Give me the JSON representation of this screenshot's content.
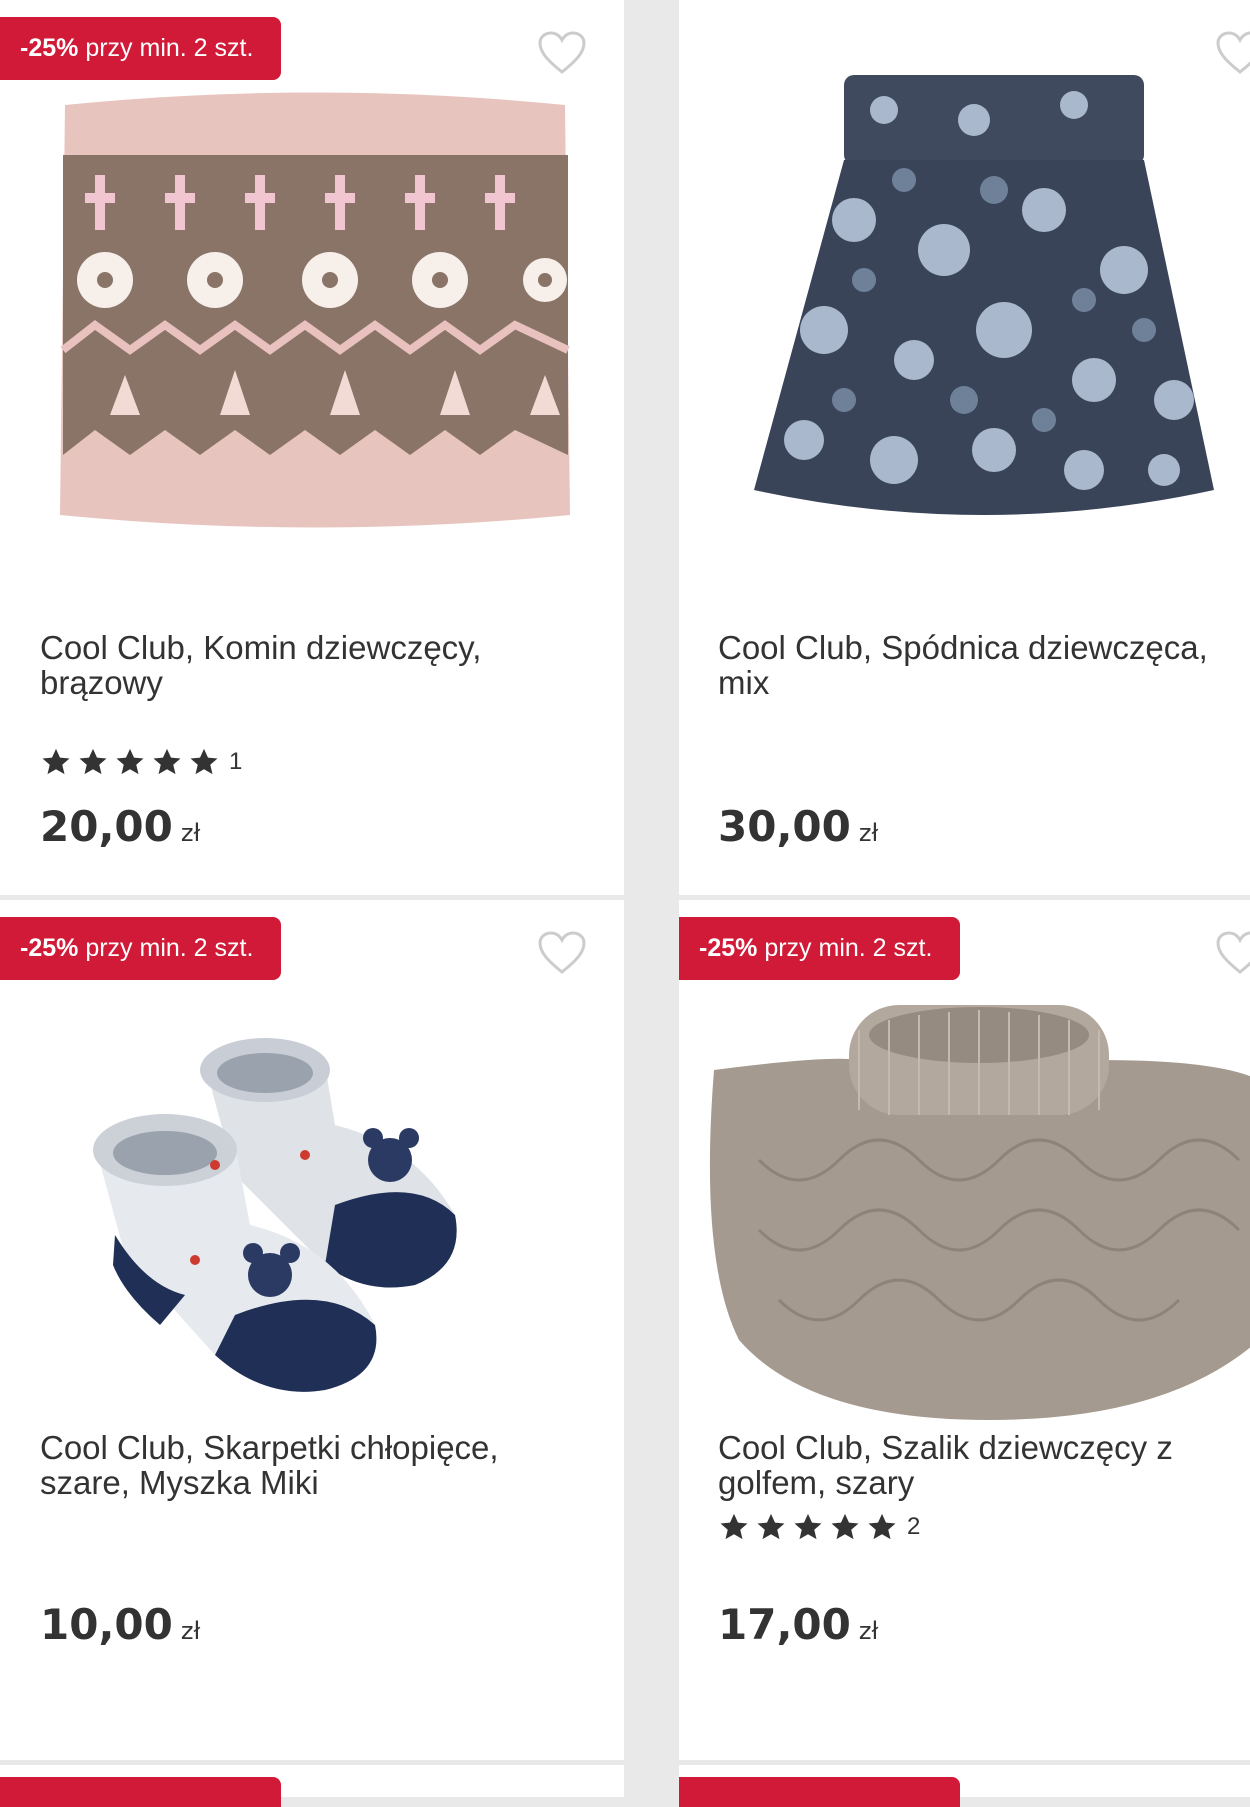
{
  "colors": {
    "badge": "#d11a38",
    "text": "#333333",
    "star": "#333333",
    "heart": "#cccccc"
  },
  "products": [
    {
      "badge": {
        "discount": "-25%",
        "text": " przy min. 2 szt."
      },
      "title": "Cool Club, Komin dziewczęcy, brązowy",
      "rating": {
        "stars": 5,
        "count": "1"
      },
      "price": {
        "amount": "20,00",
        "currency": "zł"
      },
      "image_icon": "knit-neck-warmer-image"
    },
    {
      "badge": null,
      "title": "Cool Club, Spódnica dziewczęca, mix",
      "rating": null,
      "price": {
        "amount": "30,00",
        "currency": "zł"
      },
      "image_icon": "floral-skirt-image"
    },
    {
      "badge": {
        "discount": "-25%",
        "text": " przy min. 2 szt."
      },
      "title": "Cool Club, Skarpetki chłopięce, szare, Myszka Miki",
      "rating": null,
      "price": {
        "amount": "10,00",
        "currency": "zł"
      },
      "image_icon": "baby-socks-image"
    },
    {
      "badge": {
        "discount": "-25%",
        "text": " przy min. 2 szt."
      },
      "title": "Cool Club, Szalik dziewczęcy z golfem, szary",
      "rating": {
        "stars": 5,
        "count": "2"
      },
      "price": {
        "amount": "17,00",
        "currency": "zł"
      },
      "image_icon": "turtleneck-scarf-image"
    }
  ]
}
